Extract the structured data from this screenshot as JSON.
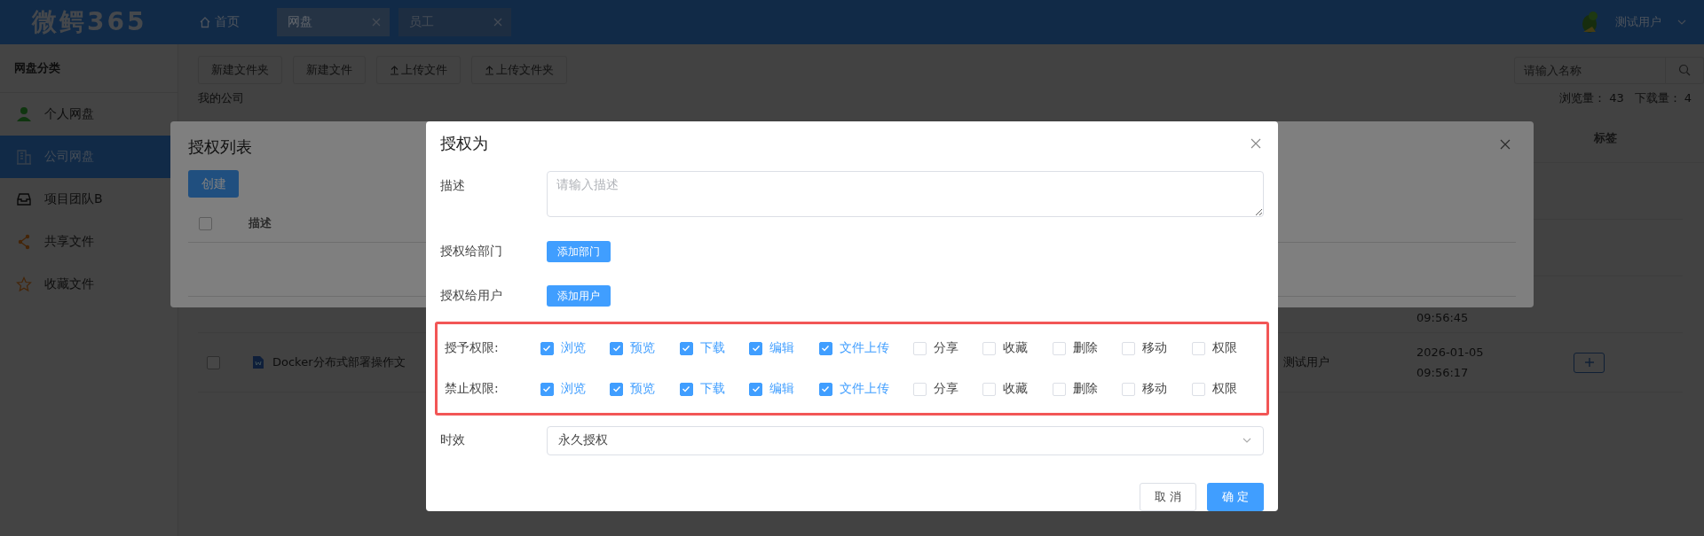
{
  "header": {
    "logo": "微鳄365",
    "home": "首页",
    "tabs": [
      {
        "label": "网盘",
        "selected": true
      },
      {
        "label": "员工",
        "selected": false
      }
    ],
    "user": "测试用户"
  },
  "sidebar": {
    "title": "网盘分类",
    "items": [
      {
        "label": "个人网盘",
        "kind": "user",
        "selected": false
      },
      {
        "label": "公司网盘",
        "kind": "building",
        "selected": true
      },
      {
        "label": "项目团队B",
        "kind": "inbox",
        "selected": false
      },
      {
        "label": "共享文件",
        "kind": "share",
        "selected": false
      },
      {
        "label": "收藏文件",
        "kind": "star",
        "selected": false
      }
    ]
  },
  "toolbar": {
    "buttons": [
      {
        "label": "新建文件夹",
        "kind": "plain"
      },
      {
        "label": "新建文件",
        "kind": "plain"
      },
      {
        "label": "上传文件",
        "kind": "upload"
      },
      {
        "label": "上传文件夹",
        "kind": "upload"
      }
    ],
    "search_placeholder": "请输入名称"
  },
  "breadcrumb": "我的公司",
  "stats": {
    "views_label": "浏览量：",
    "views": "43",
    "downloads_label": "下载量：",
    "downloads": "4"
  },
  "table": {
    "columns": {
      "tag": "标签"
    },
    "rows": [
      {
        "time": "09:56:45"
      },
      {
        "checked": false,
        "name": "Docker分布式部署操作文",
        "owner": "测试用户",
        "date": "2026-01-05",
        "time": "09:56:17"
      }
    ]
  },
  "auth_list_dialog": {
    "title": "授权列表",
    "create": "创建",
    "select_all_checked": false,
    "columns": [
      "描述"
    ]
  },
  "grant_dialog": {
    "title": "授权为",
    "description_label": "描述",
    "description_placeholder": "请输入描述",
    "dept_label": "授权给部门",
    "dept_button": "添加部门",
    "user_label": "授权给用户",
    "user_button": "添加用户",
    "permission_rows": [
      {
        "label": "授予权限:",
        "options": [
          {
            "label": "浏览",
            "checked": true
          },
          {
            "label": "预览",
            "checked": true
          },
          {
            "label": "下载",
            "checked": true
          },
          {
            "label": "编辑",
            "checked": true
          },
          {
            "label": "文件上传",
            "checked": true
          },
          {
            "label": "分享",
            "checked": false
          },
          {
            "label": "收藏",
            "checked": false
          },
          {
            "label": "删除",
            "checked": false
          },
          {
            "label": "移动",
            "checked": false
          },
          {
            "label": "权限",
            "checked": false
          }
        ]
      },
      {
        "label": "禁止权限:",
        "options": [
          {
            "label": "浏览",
            "checked": true
          },
          {
            "label": "预览",
            "checked": true
          },
          {
            "label": "下载",
            "checked": true
          },
          {
            "label": "编辑",
            "checked": true
          },
          {
            "label": "文件上传",
            "checked": true
          },
          {
            "label": "分享",
            "checked": false
          },
          {
            "label": "收藏",
            "checked": false
          },
          {
            "label": "删除",
            "checked": false
          },
          {
            "label": "移动",
            "checked": false
          },
          {
            "label": "权限",
            "checked": false
          }
        ]
      }
    ],
    "validity_label": "时效",
    "validity_value": "永久授权",
    "cancel": "取 消",
    "confirm": "确 定"
  }
}
